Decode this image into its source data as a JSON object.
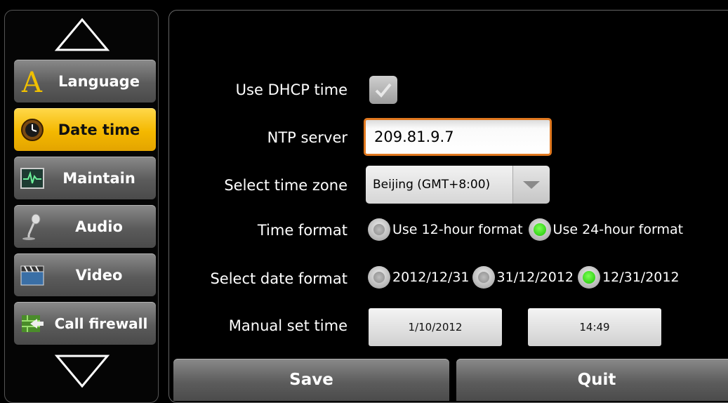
{
  "sidebar": {
    "items": [
      {
        "label": "Language",
        "icon": "language-a-icon",
        "active": false
      },
      {
        "label": "Date time",
        "icon": "clock-icon",
        "active": true
      },
      {
        "label": "Maintain",
        "icon": "monitor-waveform-icon",
        "active": false
      },
      {
        "label": "Audio",
        "icon": "microphone-icon",
        "active": false
      },
      {
        "label": "Video",
        "icon": "clapperboard-icon",
        "active": false
      },
      {
        "label": "Call firewall",
        "icon": "firewall-icon",
        "active": false
      }
    ],
    "accent_color": "#f4b800"
  },
  "form": {
    "dhcp": {
      "label": "Use DHCP time",
      "checked": true
    },
    "ntp": {
      "label": "NTP server",
      "value": "209.81.9.7"
    },
    "timezone": {
      "label": "Select time zone",
      "selected": "Beijing (GMT+8:00)"
    },
    "time_format": {
      "label": "Time format",
      "options": [
        "Use 12-hour format",
        "Use 24-hour format"
      ],
      "selected_index": 1
    },
    "date_format": {
      "label": "Select date format",
      "options": [
        "2012/12/31",
        "31/12/2012",
        "12/31/2012"
      ],
      "selected_index": 2
    },
    "manual": {
      "label": "Manual set time",
      "date": "1/10/2012",
      "time": "14:49"
    }
  },
  "actions": {
    "save": "Save",
    "quit": "Quit"
  },
  "colors": {
    "focus_border": "#e0781f",
    "radio_on": "#18c300"
  }
}
